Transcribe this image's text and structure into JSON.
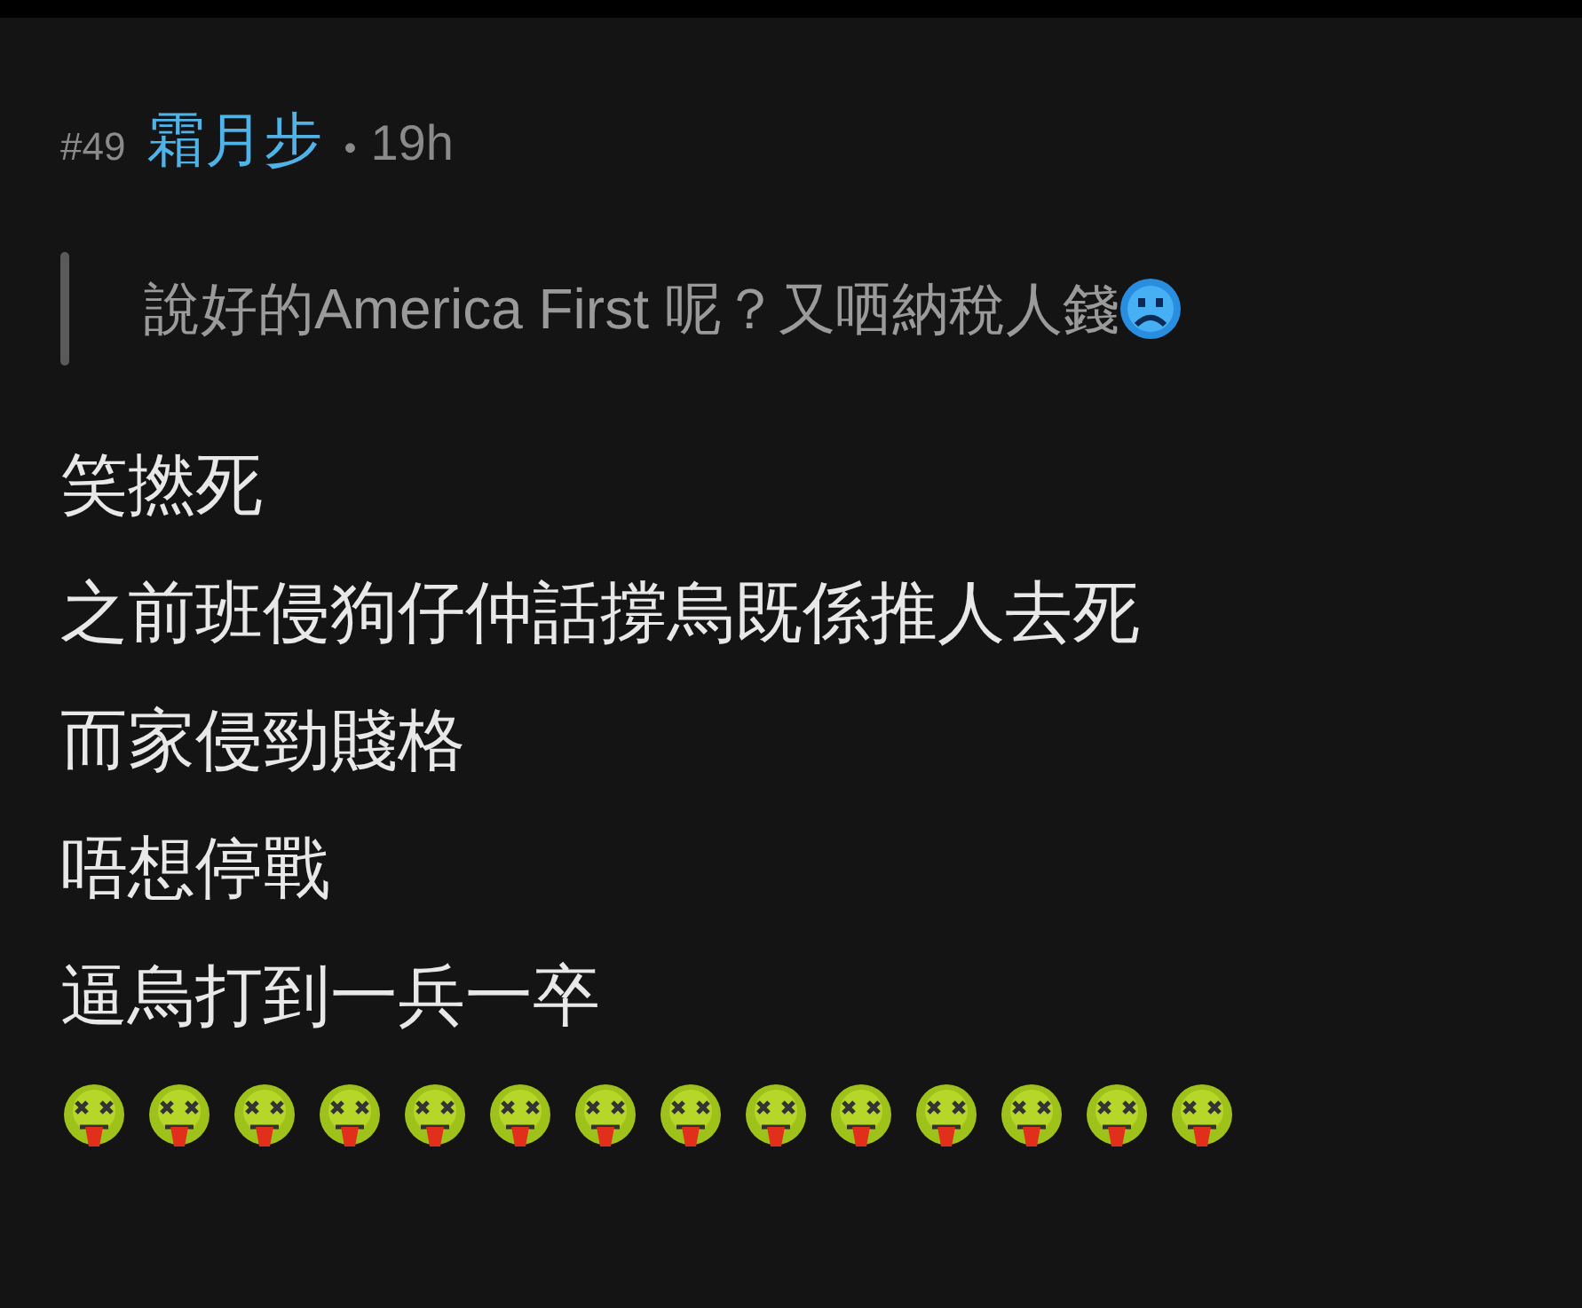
{
  "post": {
    "number": "#49",
    "author": "霜月步",
    "separator": "•",
    "time": "19h"
  },
  "quote": {
    "text": "說好的America First 呢？又哂納稅人錢",
    "emoji": {
      "kind": "sad"
    }
  },
  "lines": [
    "笑撚死",
    "之前班侵狗仔仲話撐烏既係推人去死",
    "而家侵勁賤格",
    "唔想停戰",
    "逼烏打到一兵一卒"
  ],
  "emoji_row": [
    {
      "kind": "sick"
    },
    {
      "kind": "sick"
    },
    {
      "kind": "sick"
    },
    {
      "kind": "sick"
    },
    {
      "kind": "sick"
    },
    {
      "kind": "sick"
    },
    {
      "kind": "sick"
    },
    {
      "kind": "sick"
    },
    {
      "kind": "sick"
    },
    {
      "kind": "sick"
    },
    {
      "kind": "sick"
    },
    {
      "kind": "sick"
    },
    {
      "kind": "sick"
    },
    {
      "kind": "sick"
    }
  ]
}
